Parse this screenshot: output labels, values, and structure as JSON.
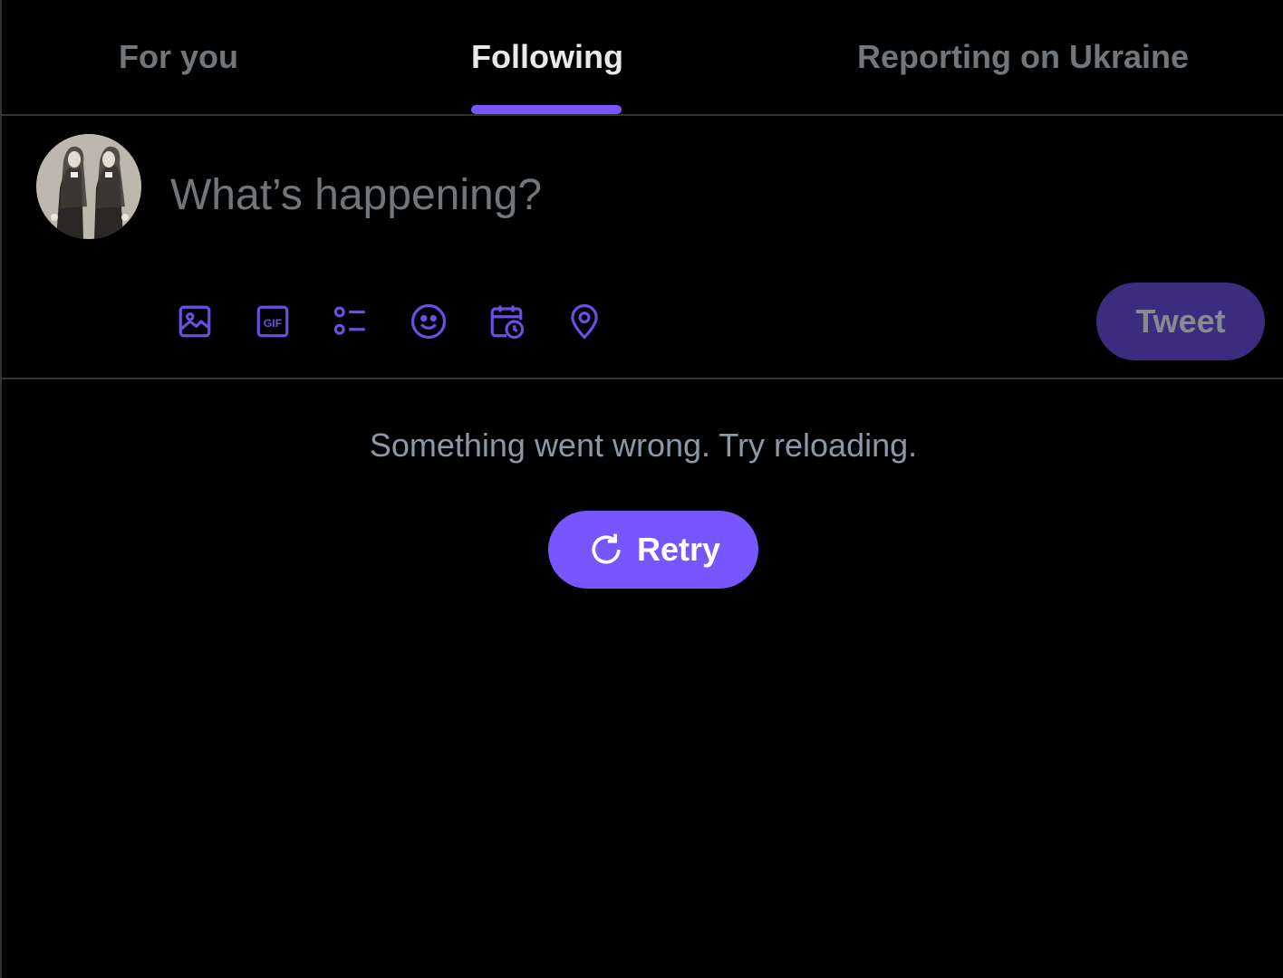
{
  "tabs": [
    {
      "label": "For you",
      "active": false
    },
    {
      "label": "Following",
      "active": true
    },
    {
      "label": "Reporting on Ukraine",
      "active": false
    }
  ],
  "composer": {
    "placeholder": "What’s happening?",
    "tools": [
      "image-icon",
      "gif-icon",
      "poll-icon",
      "emoji-icon",
      "schedule-icon",
      "location-icon"
    ],
    "tweet_label": "Tweet"
  },
  "error": {
    "message": "Something went wrong. Try reloading.",
    "retry_label": "Retry"
  },
  "colors": {
    "accent": "#7856ff",
    "accent_disabled": "#3b2c80",
    "background": "#000000",
    "border": "#2f3336",
    "muted_text": "#71767b"
  }
}
